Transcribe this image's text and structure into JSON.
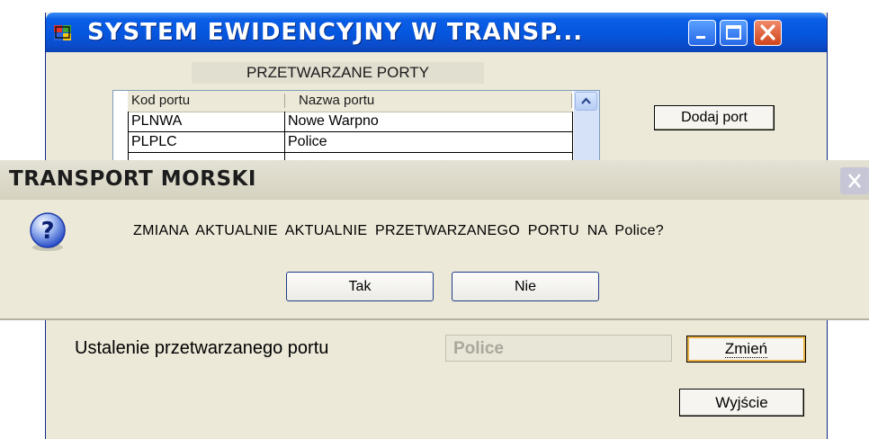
{
  "window": {
    "title": "SYSTEM EWIDENCYJNY W TRANSP...",
    "icon": "app-icon"
  },
  "main": {
    "section_title": "PRZETWARZANE PORTY",
    "table": {
      "columns": [
        "Kod portu",
        "Nazwa portu"
      ],
      "rows": [
        {
          "code": "PLNWA",
          "name": "Nowe Warpno"
        },
        {
          "code": "PLPLC",
          "name": "Police"
        }
      ]
    },
    "add_port_label": "Dodaj port",
    "port_label": "Ustalenie przetwarzanego portu",
    "current_port_value": "Police",
    "change_label": "Zmień",
    "exit_label": "Wyjście"
  },
  "dialog": {
    "title": "TRANSPORT MORSKI",
    "icon": "question-icon",
    "message": "ZMIANA AKTUALNIE AKTUALNIE PRZETWARZANEGO PORTU NA Police?",
    "yes_label": "Tak",
    "no_label": "Nie"
  },
  "colors": {
    "titlebar_blue": "#0556de",
    "window_face": "#ece9d8",
    "close_red": "#d0441c"
  }
}
